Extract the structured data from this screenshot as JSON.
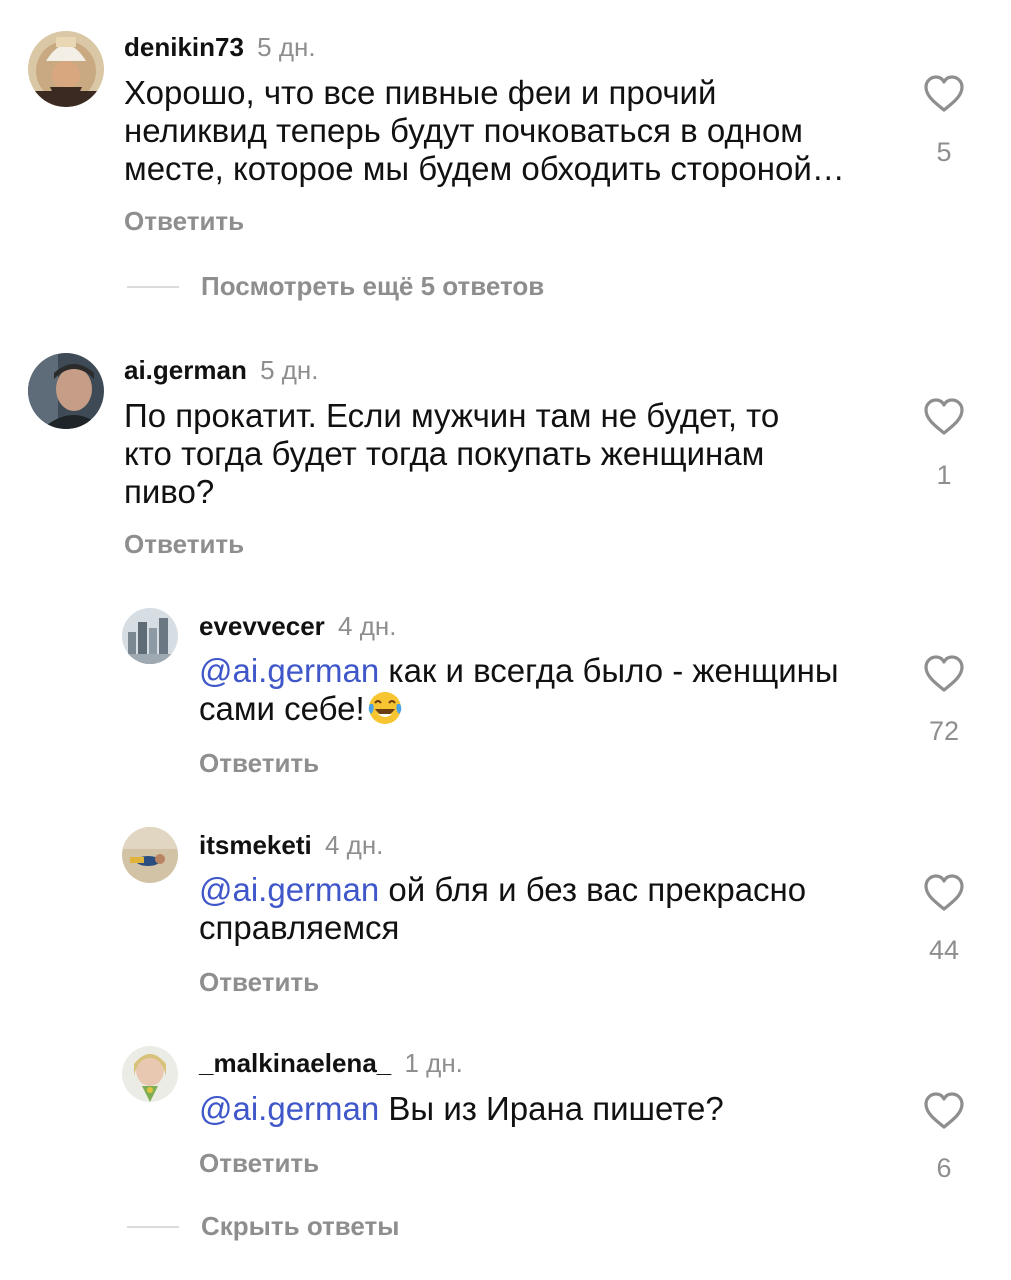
{
  "reply_label": "Ответить",
  "comments": [
    {
      "username": "denikin73",
      "time": "5 дн.",
      "lines": [
        "Хорошо, что все  пивные феи и прочий",
        "неликвид теперь будут почковаться в одном",
        "месте, которое мы будем обходить стороной…"
      ],
      "likes": "5",
      "replies_toggle": "Посмотреть ещё 5 ответов"
    },
    {
      "username": "ai.german",
      "time": "5 дн.",
      "lines": [
        "По прокатит. Если мужчин там не будет, то",
        "кто тогда будет тогда покупать женщинам",
        "пиво?"
      ],
      "likes": "1"
    }
  ],
  "replies": [
    {
      "username": "evevvecer",
      "time": "4 дн.",
      "mention": "@ai.german",
      "line1": " как и всегда было - женщины",
      "line2": "сами себе!",
      "emoji": "face-with-tears-of-joy",
      "likes": "72"
    },
    {
      "username": "itsmeketi",
      "time": "4 дн.",
      "mention": "@ai.german",
      "line1": " ой бля и без вас прекрасно",
      "line2": "справляемся",
      "likes": "44"
    },
    {
      "username": "_malkinaelena_",
      "time": "1 дн.",
      "mention": "@ai.german",
      "line1": " Вы из Ирана пишете?",
      "likes": "6"
    }
  ],
  "hide_replies": "Скрыть ответы",
  "colors": {
    "mention": "#3f57c9",
    "secondary": "#8e8e8e",
    "text": "#111111"
  }
}
